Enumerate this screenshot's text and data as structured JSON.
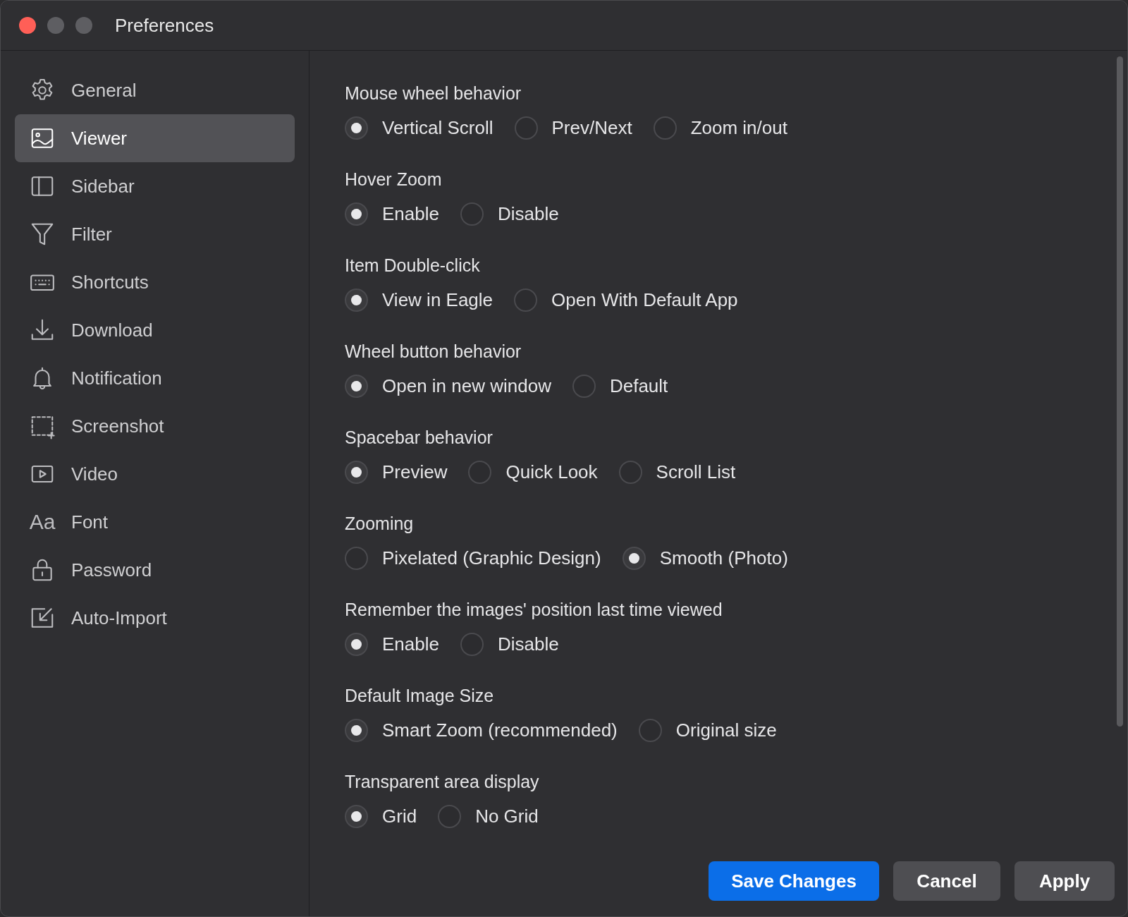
{
  "window": {
    "title": "Preferences"
  },
  "sidebar": {
    "items": [
      {
        "label": "General",
        "selected": false
      },
      {
        "label": "Viewer",
        "selected": true
      },
      {
        "label": "Sidebar",
        "selected": false
      },
      {
        "label": "Filter",
        "selected": false
      },
      {
        "label": "Shortcuts",
        "selected": false
      },
      {
        "label": "Download",
        "selected": false
      },
      {
        "label": "Notification",
        "selected": false
      },
      {
        "label": "Screenshot",
        "selected": false
      },
      {
        "label": "Video",
        "selected": false
      },
      {
        "label": "Font",
        "selected": false,
        "icon_text": "Aa"
      },
      {
        "label": "Password",
        "selected": false
      },
      {
        "label": "Auto-Import",
        "selected": false
      }
    ]
  },
  "settings": [
    {
      "label": "Mouse wheel behavior",
      "options": [
        {
          "label": "Vertical Scroll",
          "selected": true
        },
        {
          "label": "Prev/Next",
          "selected": false
        },
        {
          "label": "Zoom in/out",
          "selected": false
        }
      ]
    },
    {
      "label": "Hover Zoom",
      "options": [
        {
          "label": "Enable",
          "selected": true
        },
        {
          "label": "Disable",
          "selected": false
        }
      ]
    },
    {
      "label": "Item Double-click",
      "options": [
        {
          "label": "View in Eagle",
          "selected": true
        },
        {
          "label": "Open With Default App",
          "selected": false
        }
      ]
    },
    {
      "label": "Wheel button behavior",
      "options": [
        {
          "label": "Open in new window",
          "selected": true
        },
        {
          "label": "Default",
          "selected": false
        }
      ]
    },
    {
      "label": "Spacebar behavior",
      "options": [
        {
          "label": "Preview",
          "selected": true
        },
        {
          "label": "Quick Look",
          "selected": false
        },
        {
          "label": "Scroll List",
          "selected": false
        }
      ]
    },
    {
      "label": "Zooming",
      "options": [
        {
          "label": "Pixelated (Graphic Design)",
          "selected": false
        },
        {
          "label": "Smooth (Photo)",
          "selected": true
        }
      ]
    },
    {
      "label": "Remember the images' position last time viewed",
      "options": [
        {
          "label": "Enable",
          "selected": true
        },
        {
          "label": "Disable",
          "selected": false
        }
      ]
    },
    {
      "label": "Default Image Size",
      "options": [
        {
          "label": "Smart Zoom (recommended)",
          "selected": true
        },
        {
          "label": "Original size",
          "selected": false
        }
      ]
    },
    {
      "label": "Transparent area display",
      "options": [
        {
          "label": "Grid",
          "selected": true
        },
        {
          "label": "No Grid",
          "selected": false
        }
      ]
    }
  ],
  "buttons": [
    {
      "label": "Save Changes",
      "kind": "primary"
    },
    {
      "label": "Cancel",
      "kind": "secondary"
    },
    {
      "label": "Apply",
      "kind": "secondary"
    }
  ]
}
